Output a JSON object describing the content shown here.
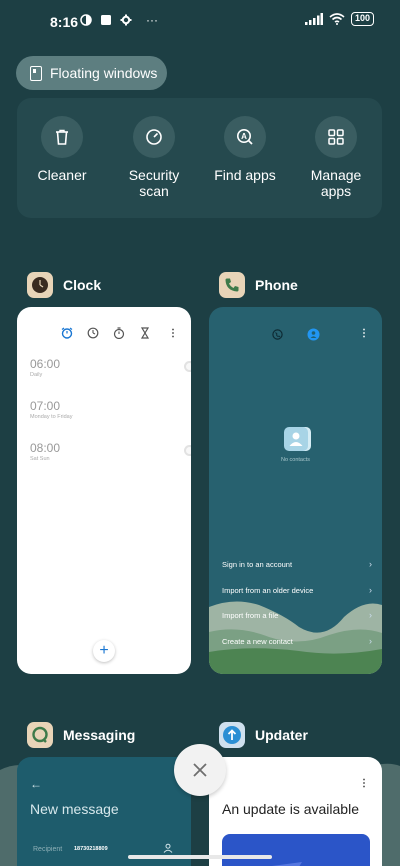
{
  "status_bar": {
    "time": "8:16",
    "battery": "100",
    "more": "···"
  },
  "floating_windows": {
    "label": "Floating windows"
  },
  "tools": [
    {
      "label": "Cleaner",
      "icon": "trash-icon"
    },
    {
      "label": "Security\nscan",
      "icon": "security-icon"
    },
    {
      "label": "Find apps",
      "icon": "find-apps-icon"
    },
    {
      "label": "Manage\napps",
      "icon": "grid-icon"
    }
  ],
  "apps": {
    "clock": {
      "name": "Clock",
      "alarms": [
        {
          "time": "06:00",
          "sub": "Daily"
        },
        {
          "time": "07:00",
          "sub": "Monday to Friday"
        },
        {
          "time": "08:00",
          "sub": "Sat Sun"
        }
      ],
      "add": "+"
    },
    "phone": {
      "name": "Phone",
      "no_contacts": "No contacts",
      "menu": [
        "Sign in to an account",
        "Import from an older device",
        "Import from a file",
        "Create a new contact"
      ]
    },
    "messaging": {
      "name": "Messaging",
      "title": "New message",
      "recipient_label": "Recipient",
      "recipient_value": "18730218809"
    },
    "updater": {
      "name": "Updater",
      "title": "An update is available"
    }
  },
  "colors": {
    "background": "#1d3f44",
    "accent": "#1976d2",
    "phone_card": "#27616f"
  }
}
